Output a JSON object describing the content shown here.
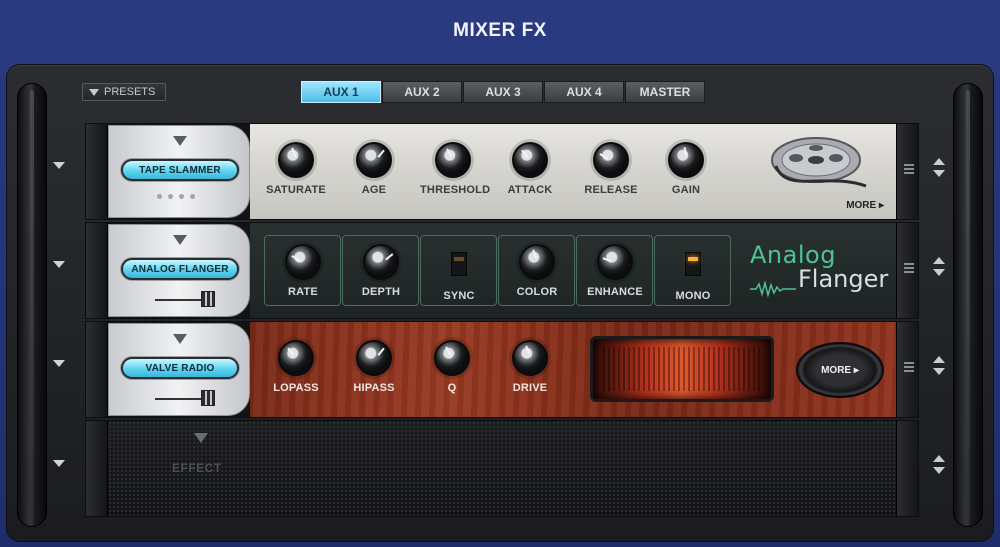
{
  "app": {
    "title": "MIXER FX"
  },
  "presets": {
    "label": "PRESETS"
  },
  "tabs": [
    {
      "label": "AUX 1",
      "active": true
    },
    {
      "label": "AUX 2",
      "active": false
    },
    {
      "label": "AUX 3",
      "active": false
    },
    {
      "label": "AUX 4",
      "active": false
    },
    {
      "label": "MASTER",
      "active": false
    }
  ],
  "slots": [
    {
      "name": "TAPE SLAMMER",
      "knobs": [
        "SATURATE",
        "AGE",
        "THRESHOLD",
        "ATTACK",
        "RELEASE",
        "GAIN"
      ],
      "more": "MORE ▸"
    },
    {
      "name": "ANALOG FLANGER",
      "controls": [
        "RATE",
        "DEPTH",
        "SYNC",
        "COLOR",
        "ENHANCE",
        "MONO"
      ],
      "brand_line1": "Analog",
      "brand_line2": "Flanger"
    },
    {
      "name": "VALVE RADIO",
      "knobs": [
        "LOPASS",
        "HIPASS",
        "Q",
        "DRIVE"
      ],
      "more": "MORE ▸"
    },
    {
      "name": "EFFECT"
    }
  ],
  "colors": {
    "accent": "#5ed4f0",
    "background": "#2a3a80",
    "flanger_brand": "#4ec292"
  }
}
